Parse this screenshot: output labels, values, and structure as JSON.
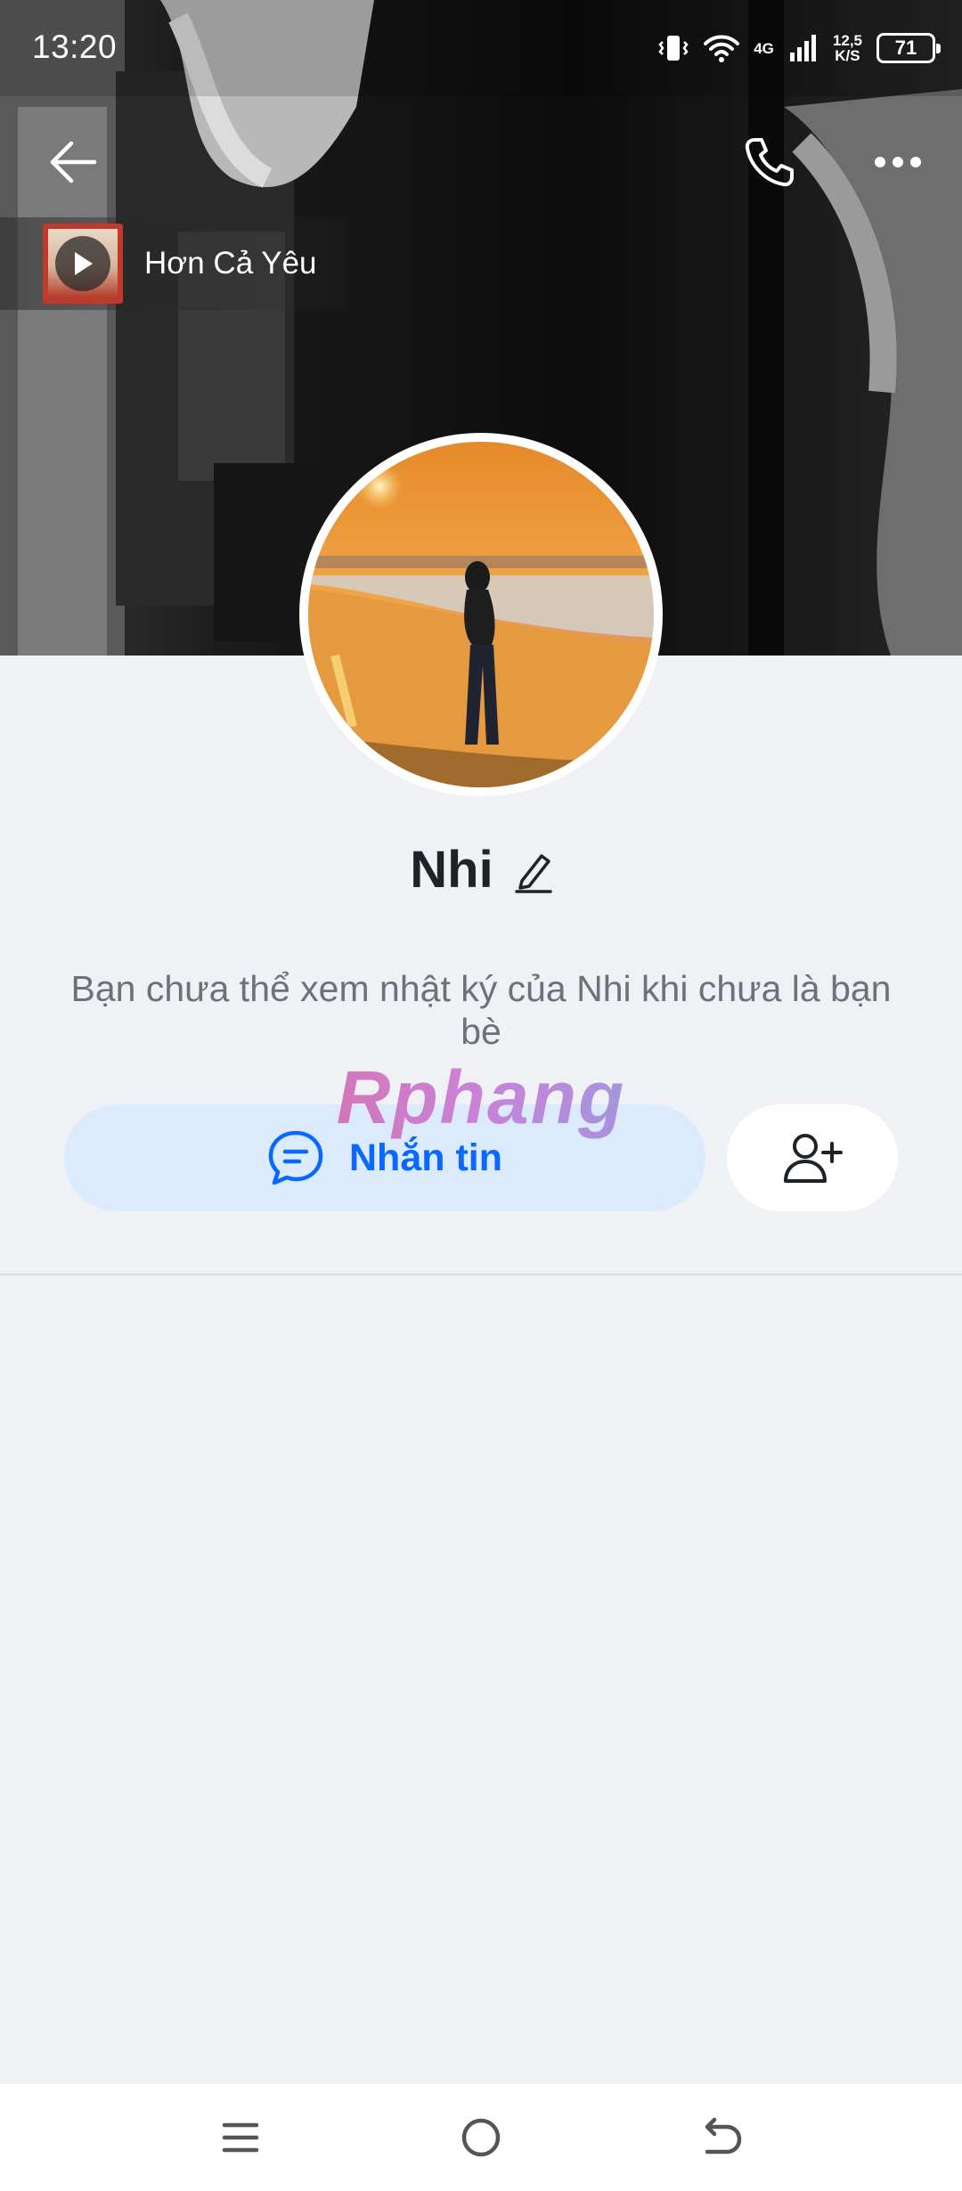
{
  "status_bar": {
    "time": "13:20",
    "network": "4G",
    "speed_value": "12,5",
    "speed_unit": "K/S",
    "battery": "71"
  },
  "music": {
    "song_title": "Hơn Cả Yêu"
  },
  "profile": {
    "name": "Nhi",
    "notice": "Bạn chưa thể xem nhật ký của Nhi khi chưa là bạn bè"
  },
  "actions": {
    "message_label": "Nhắn tin"
  },
  "watermark": "Rphang",
  "icons": {
    "back": "arrow-left-icon",
    "call": "phone-icon",
    "more": "more-dots-icon",
    "edit": "pencil-icon",
    "message": "chat-bubble-icon",
    "add_friend": "user-plus-icon"
  },
  "colors": {
    "accent": "#0a68ff",
    "message_button_bg": "#dbeafc",
    "page_bg": "#f0f1f5"
  }
}
